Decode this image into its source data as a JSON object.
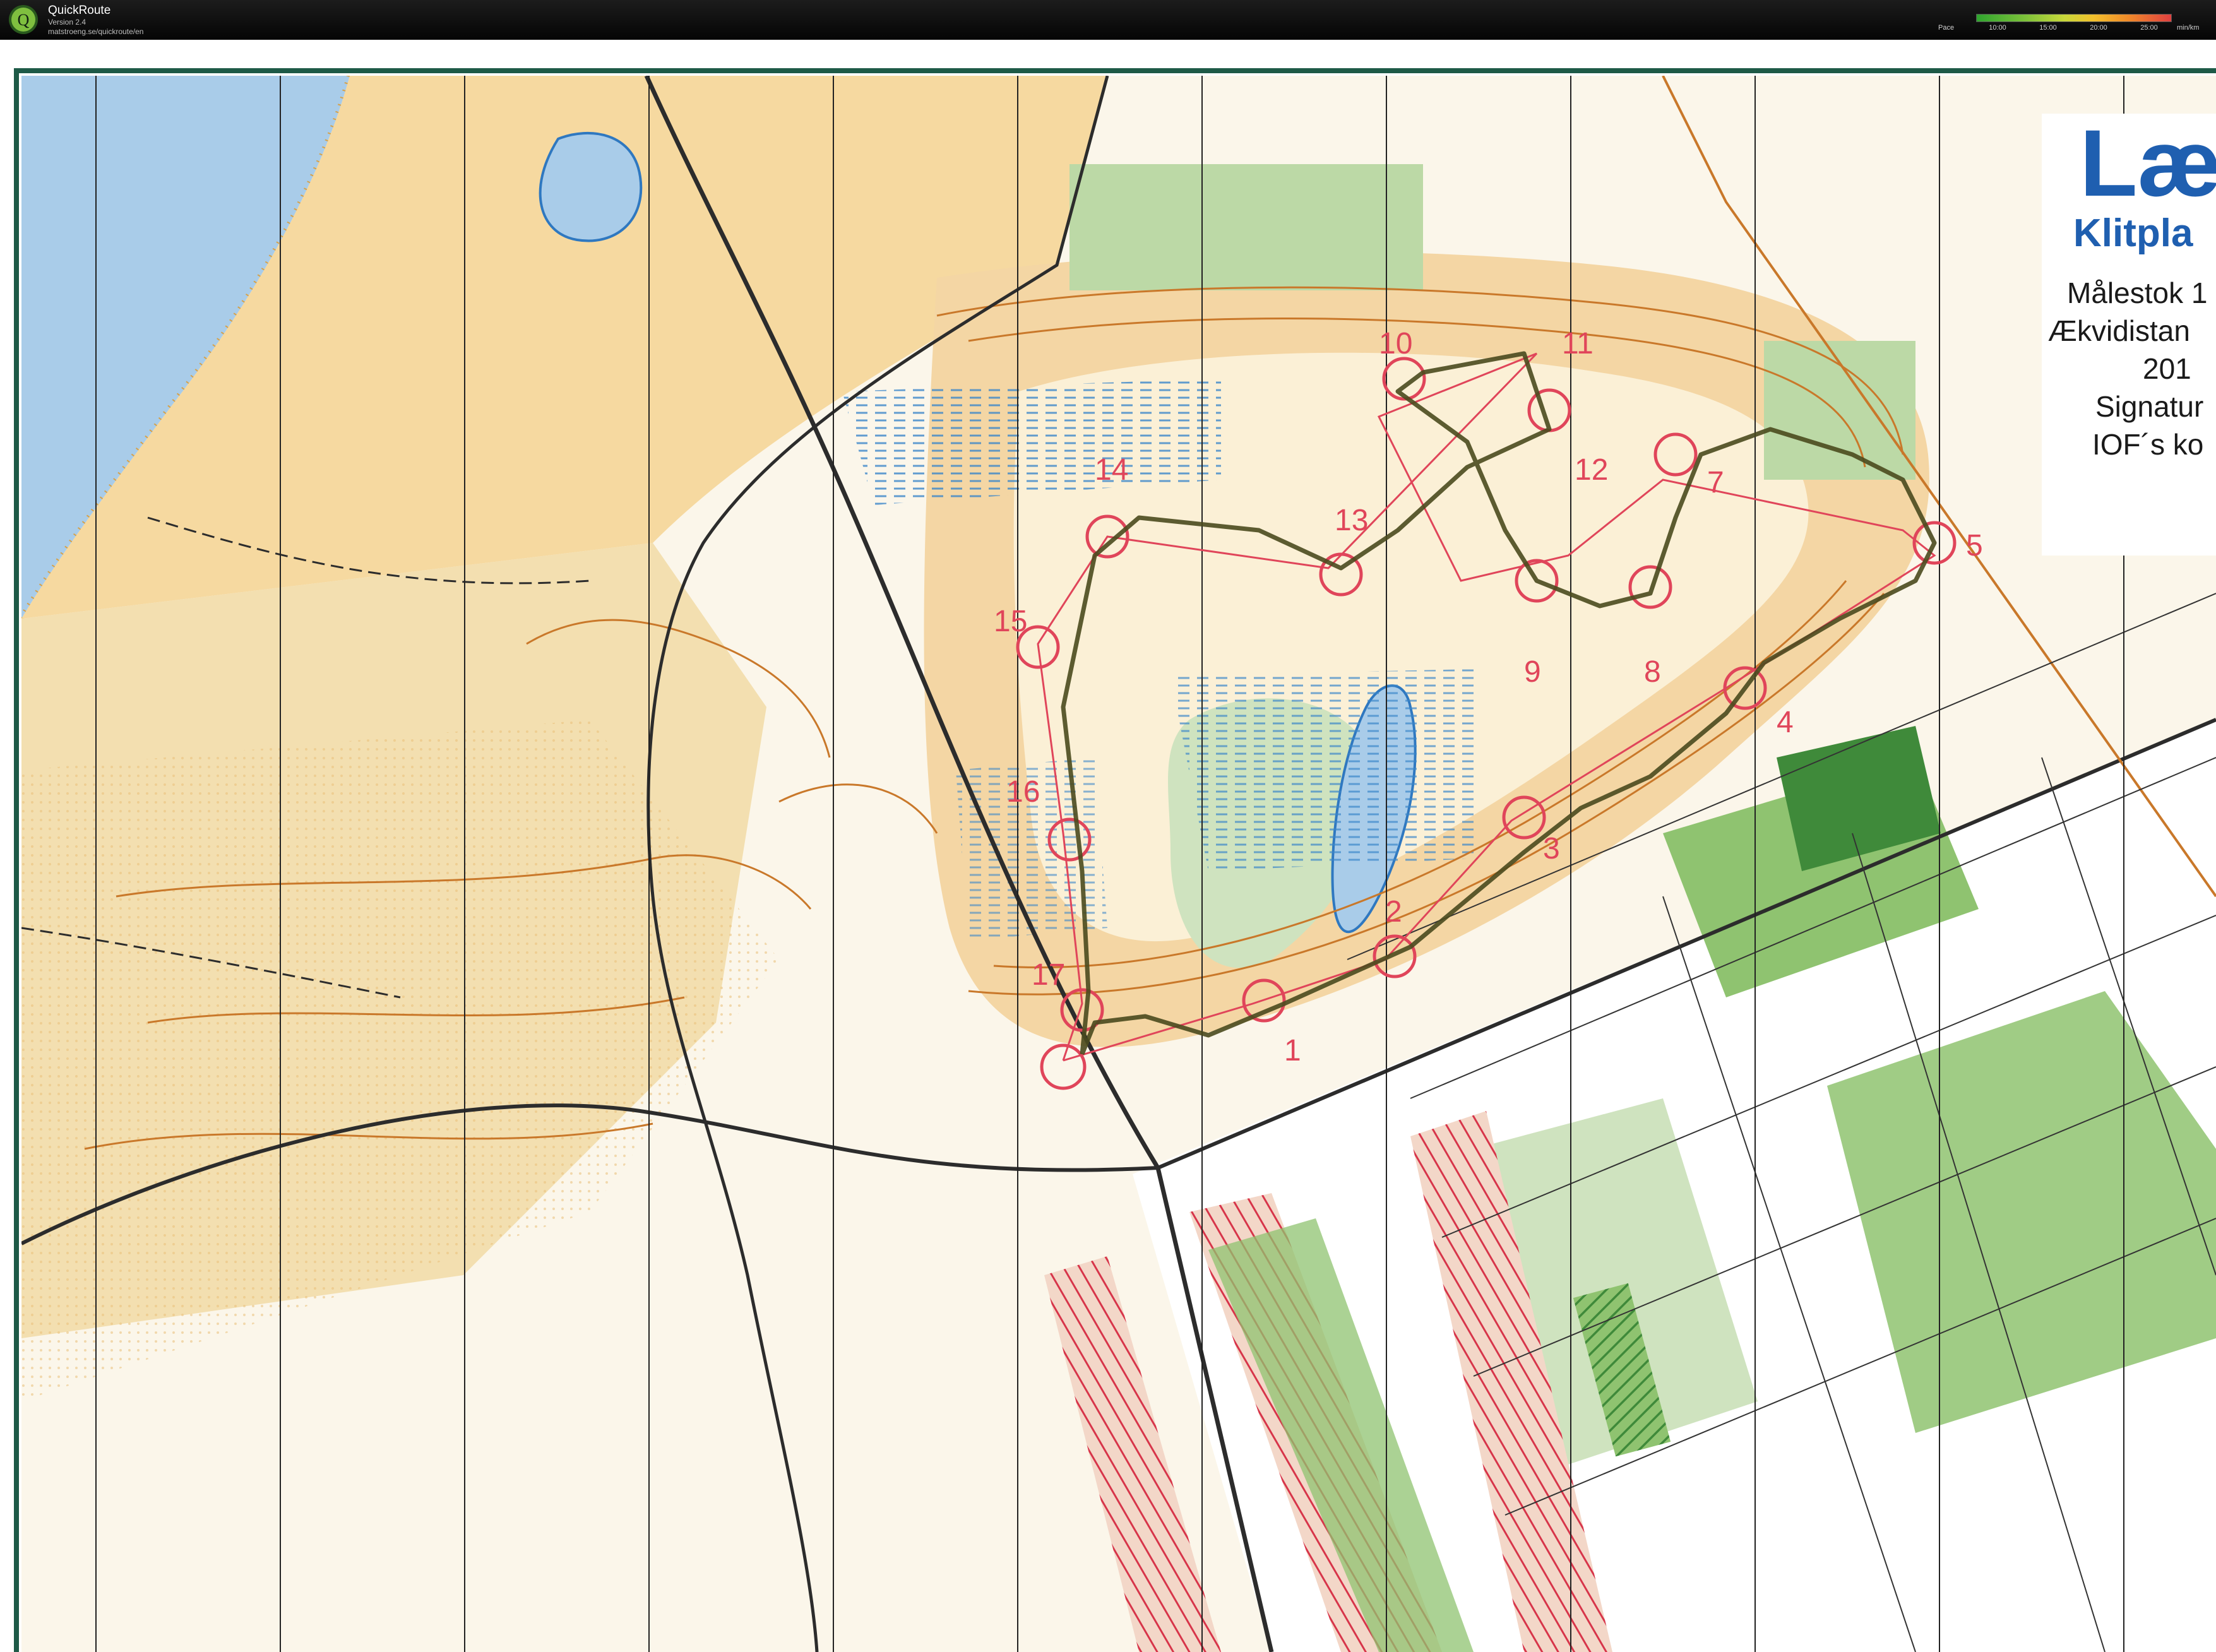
{
  "app": {
    "title": "QuickRoute",
    "version": "Version 2.4",
    "url": "matstroeng.se/quickroute/en"
  },
  "pace_legend": {
    "label": "Pace",
    "ticks": [
      "10:00",
      "15:00",
      "20:00",
      "25:00"
    ],
    "unit": "min/km",
    "colors": [
      "#2fa52f",
      "#7dc23a",
      "#c8d83a",
      "#f2c02c",
      "#f08a2a",
      "#e04040"
    ]
  },
  "map": {
    "title": "Læs",
    "subtitle": "Klitpla",
    "info_lines": [
      "Målestok 1",
      "Ækvidistan",
      "201",
      "Signatur",
      "IOF´s ko"
    ],
    "control_numbers": [
      "1",
      "2",
      "3",
      "4",
      "5",
      "7",
      "8",
      "9",
      "10",
      "11",
      "12",
      "13",
      "14",
      "15",
      "16",
      "17"
    ],
    "colors": {
      "sea": "#a9cce9",
      "open_land": "#f6d9a0",
      "forest": "#ffffff",
      "green": "#8fc370",
      "dark_green": "#3f8a3a",
      "contour": "#c9782a",
      "course": "#e0455a",
      "route": "#4a4a1e",
      "frame": "#1e5a47",
      "title_blue": "#1f5fb0"
    }
  }
}
